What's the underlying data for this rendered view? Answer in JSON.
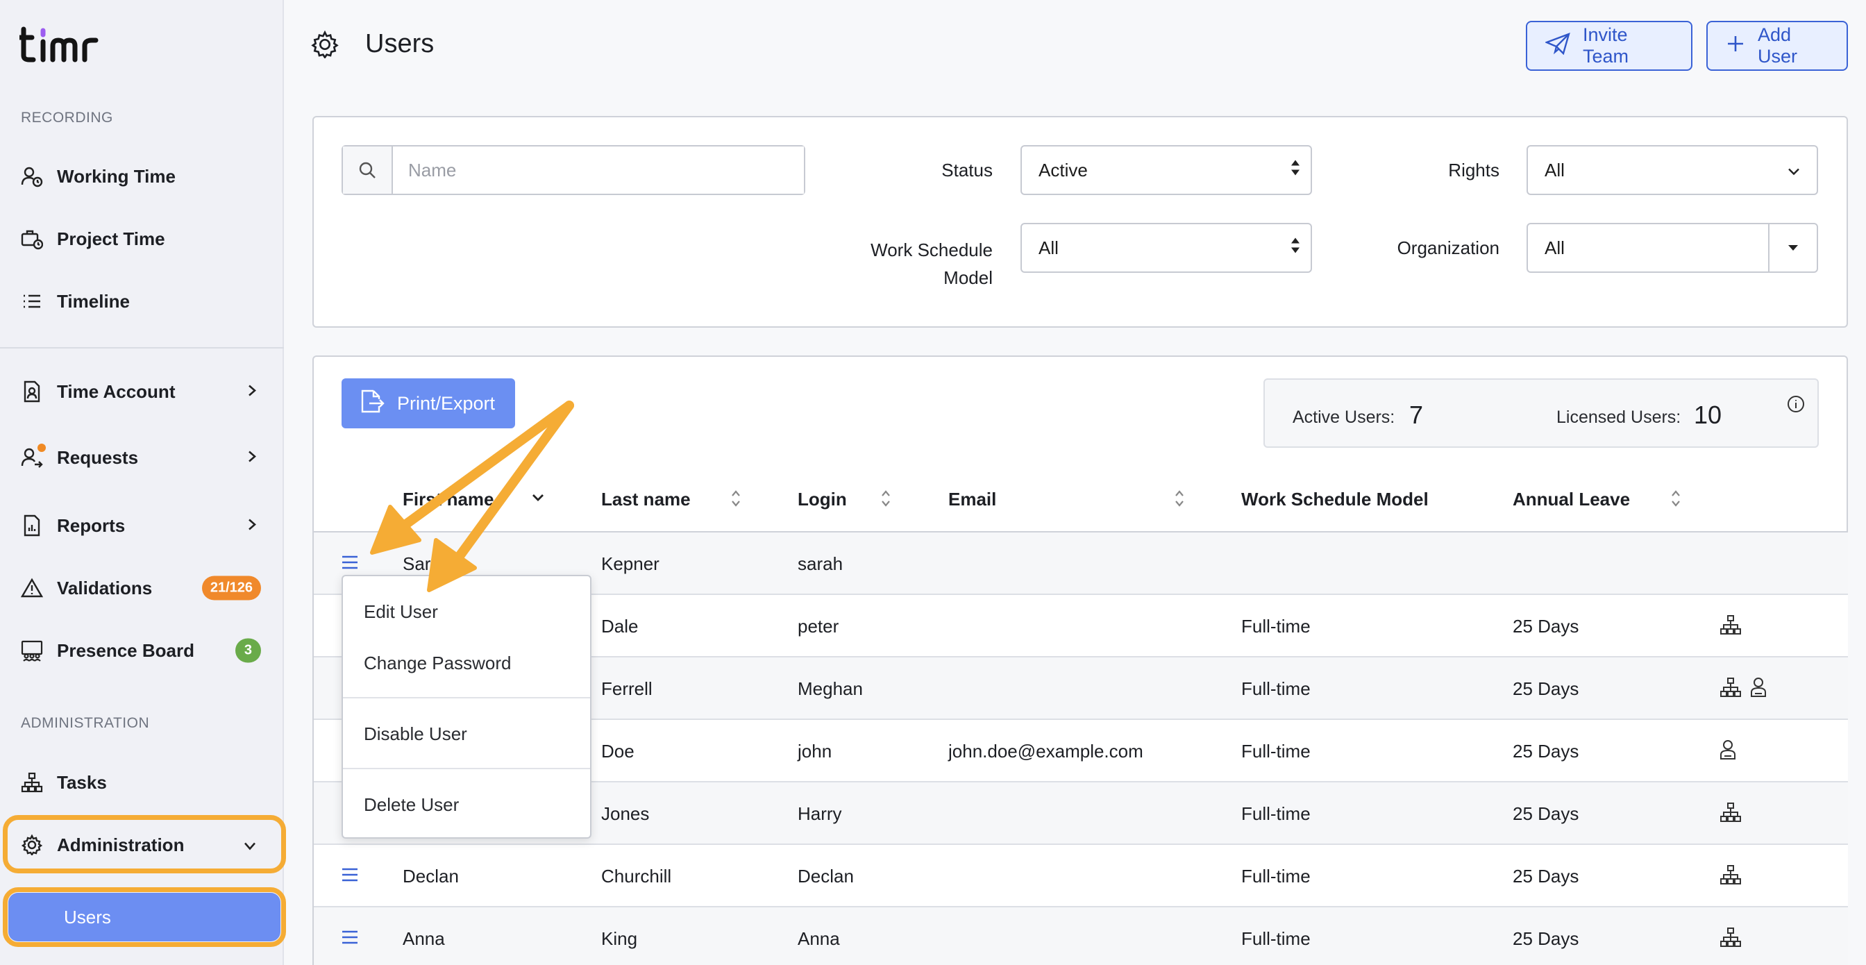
{
  "app": {
    "logo_text": "timr"
  },
  "sidebar": {
    "section_recording": "RECORDING",
    "section_administration": "ADMINISTRATION",
    "items": [
      {
        "label": "Working Time",
        "icon": "user-clock-icon"
      },
      {
        "label": "Project Time",
        "icon": "briefcase-clock-icon"
      },
      {
        "label": "Timeline",
        "icon": "list-icon"
      },
      {
        "label": "Time Account",
        "icon": "document-user-icon"
      },
      {
        "label": "Requests",
        "icon": "user-request-icon"
      },
      {
        "label": "Reports",
        "icon": "report-icon"
      },
      {
        "label": "Validations",
        "icon": "warning-icon",
        "badge": "21/126",
        "badge_color": "#f0892b"
      },
      {
        "label": "Presence Board",
        "icon": "presence-board-icon",
        "badge": "3",
        "badge_color": "#6aab4a"
      },
      {
        "label": "Tasks",
        "icon": "hierarchy-icon"
      },
      {
        "label": "Administration",
        "icon": "gear-icon"
      }
    ],
    "sub_item": "Users"
  },
  "header": {
    "title": "Users",
    "invite_team": "Invite Team",
    "add_user": "Add User"
  },
  "filters": {
    "search_placeholder": "Name",
    "status_label": "Status",
    "status_value": "Active",
    "rights_label": "Rights",
    "rights_value": "All",
    "work_schedule_label_line1": "Work Schedule",
    "work_schedule_label_line2": "Model",
    "work_schedule_value": "All",
    "organization_label": "Organization",
    "organization_value": "All"
  },
  "toolbar": {
    "print_export": "Print/Export"
  },
  "stats": {
    "active_label": "Active Users:",
    "active_value": "7",
    "licensed_label": "Licensed Users:",
    "licensed_value": "10"
  },
  "table": {
    "columns": [
      "First name",
      "Last name",
      "Login",
      "Email",
      "Work Schedule Model",
      "Annual Leave"
    ],
    "rows": [
      {
        "first": "Sara",
        "last": "Kepner",
        "login": "sarah",
        "email": "",
        "model": "",
        "leave": ""
      },
      {
        "first": "",
        "last": "Dale",
        "login": "peter",
        "email": "",
        "model": "Full-time",
        "leave": "25 Days"
      },
      {
        "first": "",
        "last": "Ferrell",
        "login": "Meghan",
        "email": "",
        "model": "Full-time",
        "leave": "25 Days"
      },
      {
        "first": "",
        "last": "Doe",
        "login": "john",
        "email": "john.doe@example.com",
        "model": "Full-time",
        "leave": "25 Days"
      },
      {
        "first": "",
        "last": "Jones",
        "login": "Harry",
        "email": "",
        "model": "Full-time",
        "leave": "25 Days"
      },
      {
        "first": "Declan",
        "last": "Churchill",
        "login": "Declan",
        "email": "",
        "model": "Full-time",
        "leave": "25 Days"
      },
      {
        "first": "Anna",
        "last": "King",
        "login": "Anna",
        "email": "",
        "model": "Full-time",
        "leave": "25 Days"
      }
    ]
  },
  "context_menu": {
    "edit_user": "Edit User",
    "change_password": "Change Password",
    "disable_user": "Disable User",
    "delete_user": "Delete User"
  },
  "colors": {
    "accent": "#6b8ff2",
    "highlight": "#f5ac35",
    "primary_text": "#2f56c9"
  }
}
